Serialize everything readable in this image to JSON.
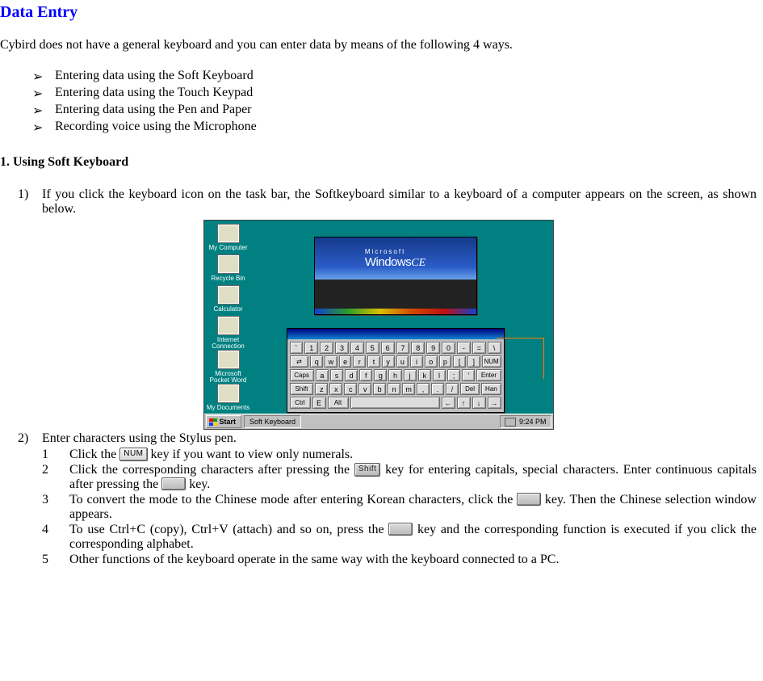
{
  "title": "Data Entry",
  "intro": "Cybird does not have a general keyboard and you can enter data by means of the following 4 ways.",
  "bullets": [
    "Entering data using the Soft Keyboard",
    "Entering data using the Touch Keypad",
    "Entering data using the Pen and Paper",
    "Recording voice using the Microphone"
  ],
  "section1": {
    "heading": "1. Using Soft Keyboard",
    "steps": [
      "If you click the keyboard icon on the task bar, the Softkeyboard similar to a keyboard of a computer appears on the screen, as shown below.",
      "Enter characters using the Stylus pen."
    ],
    "substeps": {
      "s1_pre": "Click the ",
      "s1_key": "NUM",
      "s1_post": " key if you want to view only numerals.",
      "s2_a": "Click the corresponding characters after pressing the ",
      "s2_key1": "Shift",
      "s2_b": " key for entering capitals, special characters. Enter continuous capitals after pressing the ",
      "s2_c": " key.",
      "s3_a": "To convert the mode to the Chinese mode after entering Korean characters, click the ",
      "s3_b": " key. Then the Chinese selection window appears.",
      "s4_a": "To use Ctrl+C (copy), Ctrl+V (attach) and so on, press the ",
      "s4_b": " key and the corresponding function is executed if you click the corresponding alphabet.",
      "s5": "Other functions of the keyboard operate in the same way with the keyboard connected to a PC."
    }
  },
  "screenshot": {
    "desktop_icons": [
      "My Computer",
      "Recycle Bin",
      "Calculator",
      "Internet Connection",
      "Microsoft Pocket Word",
      "My Documents"
    ],
    "splash": {
      "top": "Microsoft",
      "main": "Windows",
      "suffix": "CE"
    },
    "taskbar": {
      "start": "Start",
      "task": "Soft Keyboard",
      "time": "9:24 PM"
    },
    "kbd": {
      "row1": [
        "`",
        "1",
        "2",
        "3",
        "4",
        "5",
        "6",
        "7",
        "8",
        "9",
        "0",
        "-",
        "=",
        "\\"
      ],
      "row2_lead": "⇄",
      "row2": [
        "q",
        "w",
        "e",
        "r",
        "t",
        "y",
        "u",
        "i",
        "o",
        "p",
        "[",
        "]"
      ],
      "row2_tail": "NUM",
      "row3_lead": "Caps",
      "row3": [
        "a",
        "s",
        "d",
        "f",
        "g",
        "h",
        "j",
        "k",
        "l",
        ";",
        "'"
      ],
      "row3_tail": "Enter",
      "row4_lead": "Shift",
      "row4": [
        "z",
        "x",
        "c",
        "v",
        "b",
        "n",
        "m",
        ",",
        ".",
        "/"
      ],
      "row4_del": "Del",
      "row4_tail": "Han",
      "row5": [
        "Ctrl",
        "E",
        "Alt",
        " ",
        "←",
        "↑",
        "↓",
        "→"
      ]
    }
  }
}
